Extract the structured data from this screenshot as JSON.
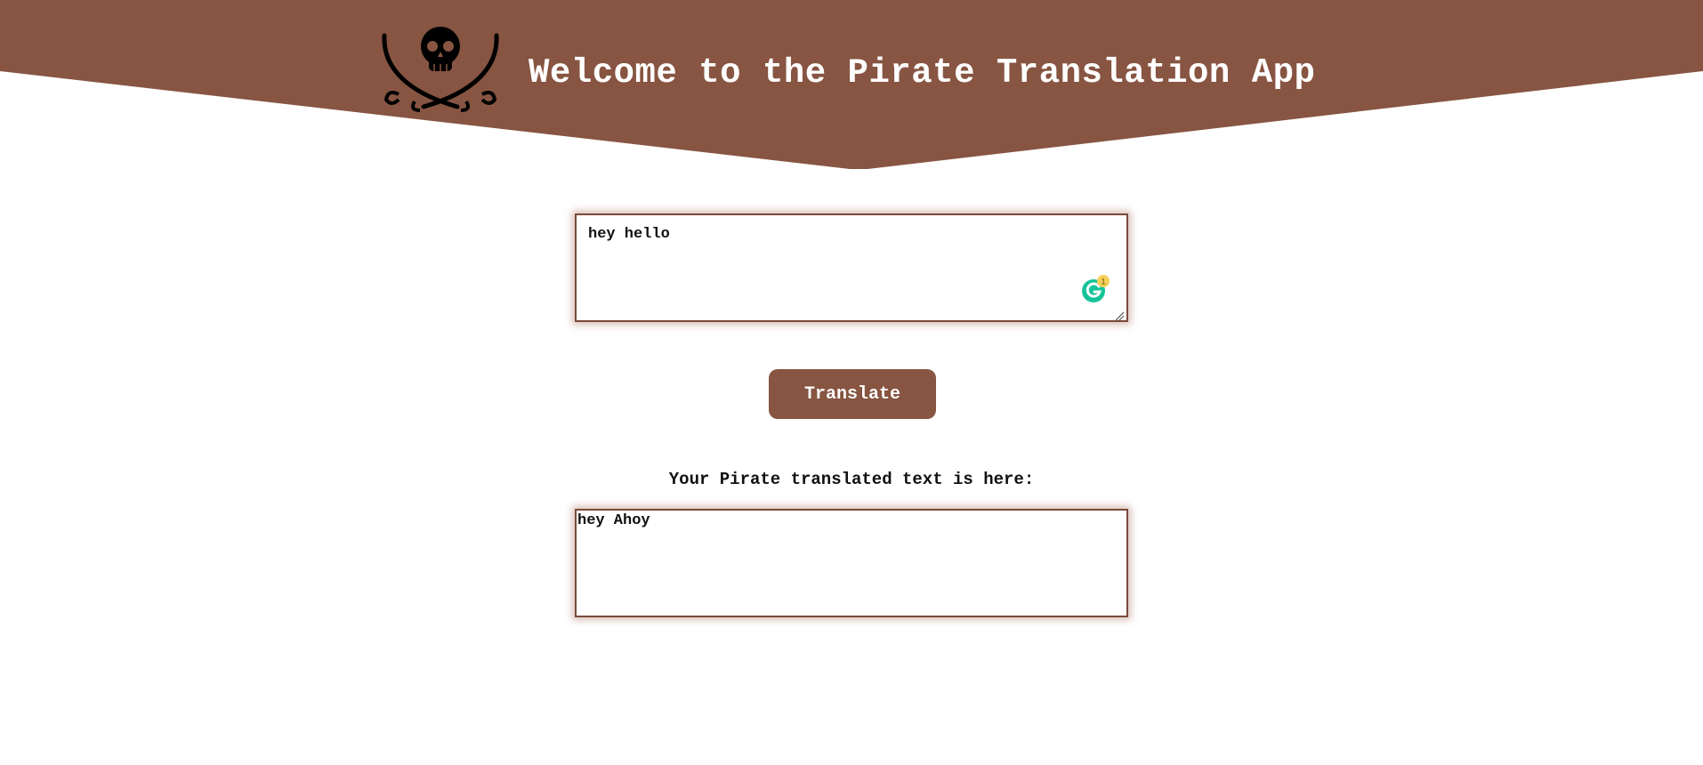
{
  "colors": {
    "brand": "#875542",
    "border": "#7a4a3a",
    "header_text": "#ffffff",
    "grammarly_green": "#15c39a",
    "grammarly_badge": "#f5d15b"
  },
  "header": {
    "title": "Welcome to the Pirate Translation App",
    "logo_icon": "skull-crossed-swords-icon"
  },
  "input": {
    "value": "hey hello",
    "grammarly_icon": "grammarly-icon",
    "grammarly_count": "1"
  },
  "translate_button": {
    "label": "Translate"
  },
  "output": {
    "label": "Your Pirate translated text is here:",
    "value": "hey Ahoy"
  }
}
